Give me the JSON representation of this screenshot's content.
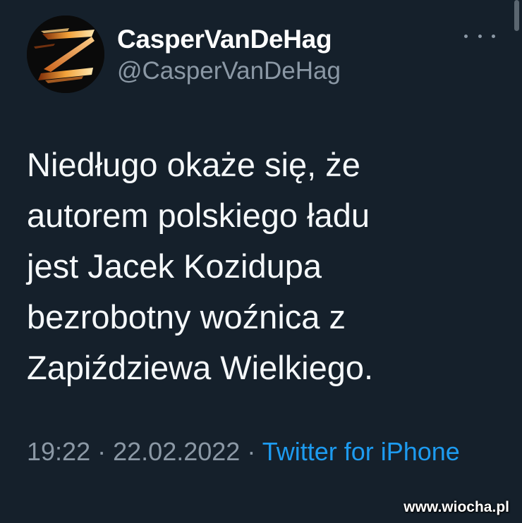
{
  "user": {
    "display_name": "CasperVanDeHag",
    "handle": "@CasperVanDeHag",
    "avatar_icon": "flaming-z-logo"
  },
  "menu": {
    "more_icon": "more-horizontal-icon"
  },
  "tweet": {
    "text": "Niedługo okaże się, że\nautorem polskiego ładu\njest Jacek Kozidupa\nbezrobotny woźnica z\nZapiździewa Wielkiego."
  },
  "meta": {
    "time": "19:22",
    "separator": "·",
    "date": "22.02.2022",
    "source": "Twitter for iPhone"
  },
  "watermark": {
    "text": "www.wiocha.pl"
  },
  "colors": {
    "background": "#15202b",
    "text": "#f5f8fa",
    "secondary": "#8b98a5",
    "link": "#1d9bf0"
  }
}
